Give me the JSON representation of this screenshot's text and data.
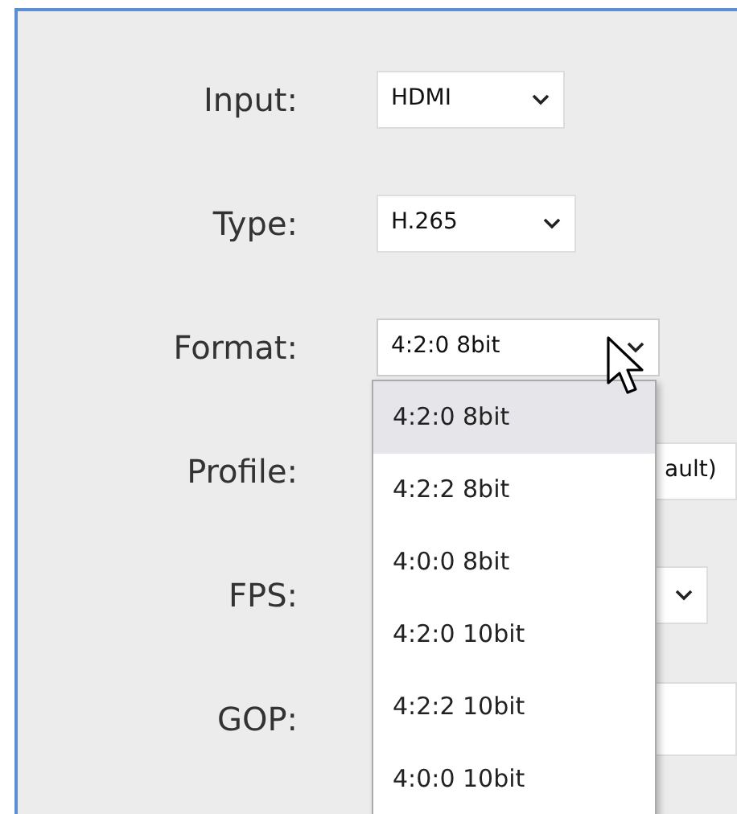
{
  "fields": [
    {
      "label": "Input:",
      "kind": "select",
      "value": "HDMI",
      "expanded": false
    },
    {
      "label": "Type:",
      "kind": "select",
      "value": "H.265",
      "expanded": false
    },
    {
      "label": "Format:",
      "kind": "select",
      "value": "4:2:0 8bit",
      "expanded": true
    },
    {
      "label": "Profile:",
      "kind": "select",
      "value": "ault)",
      "expanded": false
    },
    {
      "label": "FPS:",
      "kind": "select",
      "expanded": false
    },
    {
      "label": "GOP:",
      "kind": "input"
    }
  ],
  "format_options": [
    {
      "label": "4:2:0 8bit",
      "selected": true
    },
    {
      "label": "4:2:2 8bit",
      "selected": false
    },
    {
      "label": "4:0:0 8bit",
      "selected": false
    },
    {
      "label": "4:2:0 10bit",
      "selected": false
    },
    {
      "label": "4:2:2 10bit",
      "selected": false
    },
    {
      "label": "4:0:0 10bit",
      "selected": false
    }
  ]
}
